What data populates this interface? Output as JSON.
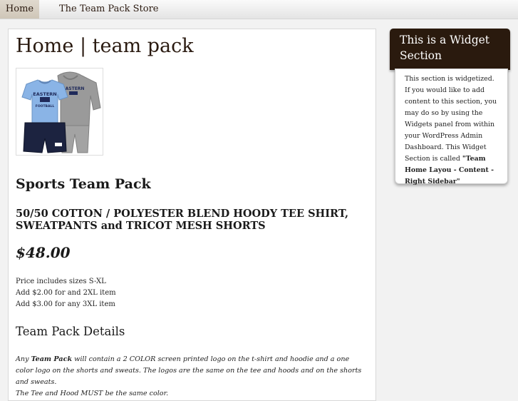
{
  "nav": {
    "home_label": "Home",
    "store_label": "The Team Pack Store"
  },
  "main": {
    "title": "Home | team pack",
    "image_alt": "team pack apparel",
    "image_text": "EASTERN FOOTBALL",
    "product_name": "Sports Team Pack",
    "product_desc": "50/50 COTTON / POLYESTER BLEND HOODY TEE SHIRT, SWEATPANTS and TRICOT MESH SHORTS",
    "price": "$48.00",
    "price_notes": [
      "Price includes sizes S-XL",
      "Add $2.00 for and 2XL item",
      "Add $3.00 for any 3XL item"
    ],
    "details_heading": "Team Pack Details",
    "details": {
      "part1": "Any ",
      "bold": "Team Pack",
      "part2": " will contain a 2 COLOR screen printed logo on the t-shirt and hoodie and a one color logo on the shorts and sweats. The logos are the same on the tee and hoods and on the shorts and sweats.",
      "line3": "The Tee and Hood MUST be the same color."
    }
  },
  "widget": {
    "title": "This is a Widget Section",
    "text_before": "This section is widgetized. If you would like to add content to this section, you may do so by using the Widgets panel from within your WordPress Admin Dashboard. This Widget Section is called ",
    "name_bold": "\"Team Home Layou - Content - Right Sidebar\"",
    "colors": {
      "header_bg": "#2a1a0e",
      "accent": "#2b1a10"
    }
  }
}
